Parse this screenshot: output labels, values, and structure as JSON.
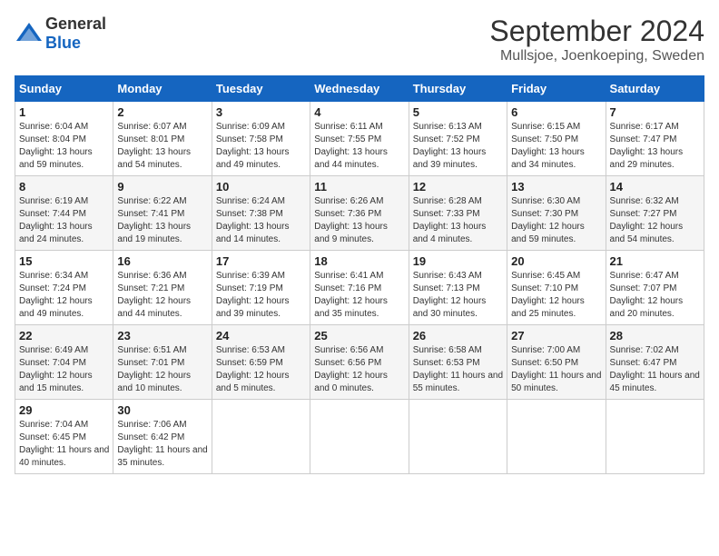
{
  "header": {
    "logo_general": "General",
    "logo_blue": "Blue",
    "month_title": "September 2024",
    "location": "Mullsjoe, Joenkoeping, Sweden"
  },
  "days_of_week": [
    "Sunday",
    "Monday",
    "Tuesday",
    "Wednesday",
    "Thursday",
    "Friday",
    "Saturday"
  ],
  "weeks": [
    [
      {
        "day": "1",
        "sunrise": "6:04 AM",
        "sunset": "8:04 PM",
        "daylight": "13 hours and 59 minutes."
      },
      {
        "day": "2",
        "sunrise": "6:07 AM",
        "sunset": "8:01 PM",
        "daylight": "13 hours and 54 minutes."
      },
      {
        "day": "3",
        "sunrise": "6:09 AM",
        "sunset": "7:58 PM",
        "daylight": "13 hours and 49 minutes."
      },
      {
        "day": "4",
        "sunrise": "6:11 AM",
        "sunset": "7:55 PM",
        "daylight": "13 hours and 44 minutes."
      },
      {
        "day": "5",
        "sunrise": "6:13 AM",
        "sunset": "7:52 PM",
        "daylight": "13 hours and 39 minutes."
      },
      {
        "day": "6",
        "sunrise": "6:15 AM",
        "sunset": "7:50 PM",
        "daylight": "13 hours and 34 minutes."
      },
      {
        "day": "7",
        "sunrise": "6:17 AM",
        "sunset": "7:47 PM",
        "daylight": "13 hours and 29 minutes."
      }
    ],
    [
      {
        "day": "8",
        "sunrise": "6:19 AM",
        "sunset": "7:44 PM",
        "daylight": "13 hours and 24 minutes."
      },
      {
        "day": "9",
        "sunrise": "6:22 AM",
        "sunset": "7:41 PM",
        "daylight": "13 hours and 19 minutes."
      },
      {
        "day": "10",
        "sunrise": "6:24 AM",
        "sunset": "7:38 PM",
        "daylight": "13 hours and 14 minutes."
      },
      {
        "day": "11",
        "sunrise": "6:26 AM",
        "sunset": "7:36 PM",
        "daylight": "13 hours and 9 minutes."
      },
      {
        "day": "12",
        "sunrise": "6:28 AM",
        "sunset": "7:33 PM",
        "daylight": "13 hours and 4 minutes."
      },
      {
        "day": "13",
        "sunrise": "6:30 AM",
        "sunset": "7:30 PM",
        "daylight": "12 hours and 59 minutes."
      },
      {
        "day": "14",
        "sunrise": "6:32 AM",
        "sunset": "7:27 PM",
        "daylight": "12 hours and 54 minutes."
      }
    ],
    [
      {
        "day": "15",
        "sunrise": "6:34 AM",
        "sunset": "7:24 PM",
        "daylight": "12 hours and 49 minutes."
      },
      {
        "day": "16",
        "sunrise": "6:36 AM",
        "sunset": "7:21 PM",
        "daylight": "12 hours and 44 minutes."
      },
      {
        "day": "17",
        "sunrise": "6:39 AM",
        "sunset": "7:19 PM",
        "daylight": "12 hours and 39 minutes."
      },
      {
        "day": "18",
        "sunrise": "6:41 AM",
        "sunset": "7:16 PM",
        "daylight": "12 hours and 35 minutes."
      },
      {
        "day": "19",
        "sunrise": "6:43 AM",
        "sunset": "7:13 PM",
        "daylight": "12 hours and 30 minutes."
      },
      {
        "day": "20",
        "sunrise": "6:45 AM",
        "sunset": "7:10 PM",
        "daylight": "12 hours and 25 minutes."
      },
      {
        "day": "21",
        "sunrise": "6:47 AM",
        "sunset": "7:07 PM",
        "daylight": "12 hours and 20 minutes."
      }
    ],
    [
      {
        "day": "22",
        "sunrise": "6:49 AM",
        "sunset": "7:04 PM",
        "daylight": "12 hours and 15 minutes."
      },
      {
        "day": "23",
        "sunrise": "6:51 AM",
        "sunset": "7:01 PM",
        "daylight": "12 hours and 10 minutes."
      },
      {
        "day": "24",
        "sunrise": "6:53 AM",
        "sunset": "6:59 PM",
        "daylight": "12 hours and 5 minutes."
      },
      {
        "day": "25",
        "sunrise": "6:56 AM",
        "sunset": "6:56 PM",
        "daylight": "12 hours and 0 minutes."
      },
      {
        "day": "26",
        "sunrise": "6:58 AM",
        "sunset": "6:53 PM",
        "daylight": "11 hours and 55 minutes."
      },
      {
        "day": "27",
        "sunrise": "7:00 AM",
        "sunset": "6:50 PM",
        "daylight": "11 hours and 50 minutes."
      },
      {
        "day": "28",
        "sunrise": "7:02 AM",
        "sunset": "6:47 PM",
        "daylight": "11 hours and 45 minutes."
      }
    ],
    [
      {
        "day": "29",
        "sunrise": "7:04 AM",
        "sunset": "6:45 PM",
        "daylight": "11 hours and 40 minutes."
      },
      {
        "day": "30",
        "sunrise": "7:06 AM",
        "sunset": "6:42 PM",
        "daylight": "11 hours and 35 minutes."
      },
      null,
      null,
      null,
      null,
      null
    ]
  ]
}
